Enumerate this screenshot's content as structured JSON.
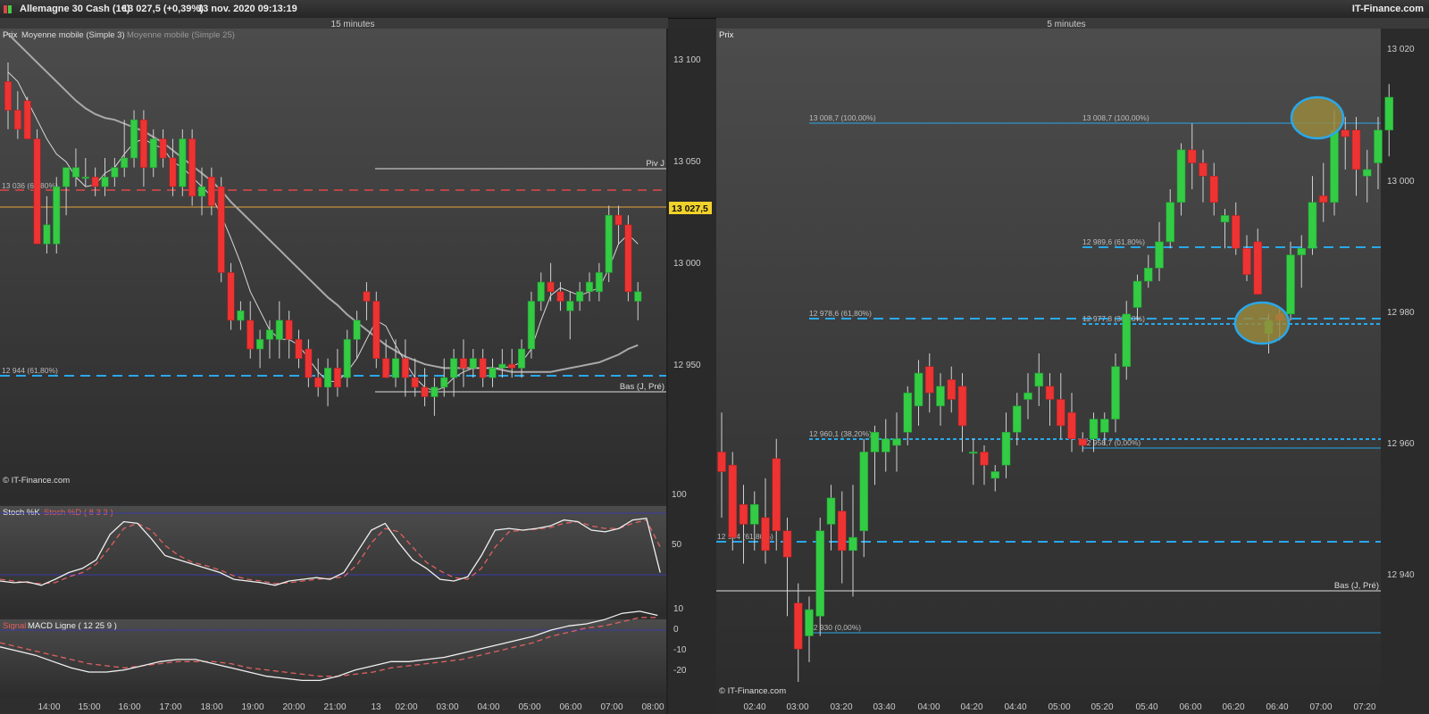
{
  "header": {
    "instrument": "Allemagne 30 Cash (1€)",
    "price": "13 027,5 (+0,39%)",
    "datetime": "13 nov. 2020 09:13:19",
    "brand": "IT-Finance.com"
  },
  "left": {
    "timeframe": "15 minutes",
    "legend": {
      "prix": "Prix",
      "ma3": "Moyenne mobile (Simple 3)",
      "ma25": "Moyenne mobile (Simple 25)"
    },
    "watermark": "© IT-Finance.com",
    "price_ticks": [
      "13 100",
      "13 050",
      "13 000",
      "12 950"
    ],
    "current_price": "13 027,5",
    "piv_label": "Piv J",
    "bas_label": "Bas (J, Pré)",
    "fib1": "13 036 (61,80%)",
    "fib2": "12 944 (61,80%)",
    "stoch": {
      "k": "Stoch %K",
      "d": "Stoch %D ( 8 3 3 )",
      "ticks": [
        "100",
        "50"
      ]
    },
    "macd": {
      "signal": "Signal",
      "line": "MACD Ligne ( 12 25 9 )",
      "ticks": [
        "10",
        "0",
        "-10",
        "-20"
      ]
    },
    "time_ticks": [
      "14:00",
      "15:00",
      "16:00",
      "17:00",
      "18:00",
      "19:00",
      "20:00",
      "21:00",
      "13",
      "02:00",
      "03:00",
      "04:00",
      "05:00",
      "06:00",
      "07:00",
      "08:00"
    ]
  },
  "right": {
    "timeframe": "5 minutes",
    "legend": {
      "prix": "Prix"
    },
    "watermark": "© IT-Finance.com",
    "price_ticks": [
      "13 020",
      "13 000",
      "12 980",
      "12 960",
      "12 940"
    ],
    "bas_label": "Bas (J, Pré)",
    "fibs": [
      "13 008,7 (100,00%)",
      "13 008,7 (100,00%)",
      "12 989,6 (61,80%)",
      "12 978,6 (61,80%)",
      "12 977,8 (38,20%)",
      "12 960,1 (38,20%)",
      "12 958,7 (0,00%)",
      "12 944 (61,80%)",
      "12 930 (0,00%)"
    ],
    "time_ticks": [
      "02:40",
      "03:00",
      "03:20",
      "03:40",
      "04:00",
      "04:20",
      "04:40",
      "05:00",
      "05:20",
      "05:40",
      "06:00",
      "06:20",
      "06:40",
      "07:00",
      "07:20"
    ]
  },
  "chart_data": [
    {
      "type": "candlestick",
      "title": "15 minutes",
      "ylim": [
        12920,
        13120
      ],
      "candles": [
        [
          13110,
          13120,
          13085,
          13095
        ],
        [
          13095,
          13105,
          13080,
          13085
        ],
        [
          13100,
          13102,
          13080,
          13080
        ],
        [
          13080,
          13085,
          13025,
          13025
        ],
        [
          13025,
          13050,
          13020,
          13035
        ],
        [
          13025,
          13060,
          13020,
          13055
        ],
        [
          13055,
          13065,
          13040,
          13065
        ],
        [
          13060,
          13075,
          13055,
          13065
        ],
        [
          13060,
          13070,
          13055,
          13060
        ],
        [
          13060,
          13065,
          13050,
          13055
        ],
        [
          13055,
          13070,
          13050,
          13060
        ],
        [
          13060,
          13070,
          13055,
          13065
        ],
        [
          13065,
          13090,
          13060,
          13070
        ],
        [
          13070,
          13095,
          13065,
          13090
        ],
        [
          13090,
          13095,
          13055,
          13065
        ],
        [
          13065,
          13085,
          13060,
          13080
        ],
        [
          13080,
          13085,
          13065,
          13070
        ],
        [
          13070,
          13080,
          13050,
          13055
        ],
        [
          13055,
          13085,
          13050,
          13080
        ],
        [
          13080,
          13085,
          13045,
          13050
        ],
        [
          13050,
          13065,
          13040,
          13055
        ],
        [
          13060,
          13065,
          13040,
          13045
        ],
        [
          13055,
          13060,
          13005,
          13010
        ],
        [
          13010,
          13015,
          12980,
          12985
        ],
        [
          12985,
          12995,
          12980,
          12990
        ],
        [
          12985,
          12995,
          12965,
          12970
        ],
        [
          12970,
          12980,
          12960,
          12975
        ],
        [
          12975,
          12985,
          12965,
          12980
        ],
        [
          12975,
          12995,
          12965,
          12985
        ],
        [
          12985,
          12990,
          12965,
          12975
        ],
        [
          12975,
          12980,
          12960,
          12965
        ],
        [
          12970,
          12975,
          12950,
          12955
        ],
        [
          12955,
          12965,
          12945,
          12950
        ],
        [
          12950,
          12965,
          12940,
          12960
        ],
        [
          12960,
          12970,
          12945,
          12950
        ],
        [
          12955,
          12980,
          12950,
          12975
        ],
        [
          12975,
          12990,
          12965,
          12985
        ],
        [
          13000,
          13005,
          12985,
          12995
        ],
        [
          12995,
          13000,
          12960,
          12965
        ],
        [
          12965,
          12975,
          12955,
          12955
        ],
        [
          12955,
          12975,
          12950,
          12965
        ],
        [
          12965,
          12975,
          12945,
          12955
        ],
        [
          12955,
          12965,
          12945,
          12950
        ],
        [
          12950,
          12960,
          12940,
          12945
        ],
        [
          12945,
          12955,
          12935,
          12950
        ],
        [
          12950,
          12965,
          12945,
          12955
        ],
        [
          12955,
          12970,
          12945,
          12965
        ],
        [
          12965,
          12975,
          12950,
          12960
        ],
        [
          12960,
          12970,
          12955,
          12965
        ],
        [
          12965,
          12970,
          12950,
          12955
        ],
        [
          12955,
          12965,
          12950,
          12960
        ],
        [
          12960,
          12970,
          12955,
          12962
        ],
        [
          12962,
          12970,
          12955,
          12960
        ],
        [
          12960,
          12975,
          12955,
          12970
        ],
        [
          12970,
          13000,
          12965,
          12995
        ],
        [
          12995,
          13010,
          12990,
          13005
        ],
        [
          13005,
          13015,
          12995,
          13000
        ],
        [
          13000,
          13005,
          12990,
          12995
        ],
        [
          12990,
          13000,
          12975,
          12995
        ],
        [
          12995,
          13005,
          12990,
          13000
        ],
        [
          13000,
          13010,
          12995,
          13005
        ],
        [
          13000,
          13015,
          12995,
          13010
        ],
        [
          13010,
          13045,
          13005,
          13040
        ],
        [
          13040,
          13045,
          13025,
          13035
        ],
        [
          13035,
          13040,
          12995,
          13000
        ],
        [
          12995,
          13005,
          12985,
          13000
        ]
      ],
      "ma3": [
        13115,
        13110,
        13100,
        13090,
        13080,
        13072,
        13068,
        13060,
        13055,
        13056,
        13062,
        13065,
        13072,
        13078,
        13080,
        13077,
        13075,
        13068,
        13065,
        13060,
        13055,
        13050,
        13040,
        13028,
        13015,
        13000,
        12990,
        12980,
        12975,
        12975,
        12972,
        12965,
        12958,
        12953,
        12953,
        12958,
        12965,
        12975,
        12985,
        12982,
        12972,
        12963,
        12955,
        12950,
        12948,
        12950,
        12955,
        12958,
        12960,
        12960,
        12960,
        12960,
        12961,
        12963,
        12970,
        12985,
        12998,
        13002,
        13000,
        12998,
        13000,
        13002,
        13012,
        13025,
        13030,
        13025
      ],
      "ma25": [
        13135,
        13130,
        13125,
        13120,
        13115,
        13110,
        13105,
        13100,
        13096,
        13093,
        13091,
        13090,
        13088,
        13086,
        13084,
        13081,
        13078,
        13074,
        13070,
        13066,
        13062,
        13058,
        13053,
        13047,
        13042,
        13037,
        13032,
        13027,
        13022,
        13017,
        13012,
        13007,
        13002,
        12997,
        12993,
        12988,
        12984,
        12980,
        12976,
        12972,
        12969,
        12966,
        12964,
        12962,
        12961,
        12960,
        12960,
        12960,
        12960,
        12960,
        12960,
        12959,
        12958,
        12958,
        12958,
        12958,
        12958,
        12959,
        12960,
        12961,
        12962,
        12963,
        12965,
        12967,
        12970,
        12972
      ],
      "levels": {
        "piv_j": 13048,
        "fib_36": 13036,
        "current": 13027.5,
        "fib_944": 12944,
        "bas": 12940
      }
    },
    {
      "type": "line",
      "title": "Stoch %K / Stoch %D ( 8 3 3 )",
      "ylim": [
        0,
        110
      ],
      "series": [
        {
          "name": "Stoch %K",
          "values": [
            20,
            18,
            19,
            15,
            22,
            30,
            35,
            45,
            75,
            90,
            88,
            70,
            50,
            45,
            40,
            35,
            30,
            22,
            20,
            18,
            15,
            20,
            22,
            24,
            22,
            30,
            55,
            80,
            88,
            65,
            45,
            35,
            22,
            20,
            25,
            50,
            80,
            82,
            80,
            82,
            85,
            92,
            90,
            80,
            78,
            82,
            92,
            94,
            30
          ]
        },
        {
          "name": "Stoch %D",
          "values": [
            22,
            20,
            18,
            17,
            18,
            25,
            30,
            40,
            60,
            82,
            88,
            80,
            62,
            50,
            42,
            38,
            33,
            26,
            22,
            20,
            17,
            18,
            20,
            22,
            23,
            25,
            40,
            65,
            82,
            78,
            60,
            42,
            32,
            24,
            22,
            35,
            60,
            78,
            80,
            81,
            83,
            88,
            90,
            85,
            82,
            82,
            88,
            92,
            60
          ]
        }
      ]
    },
    {
      "type": "line",
      "title": "MACD Ligne ( 12 25 9 )",
      "ylim": [
        -25,
        12
      ],
      "series": [
        {
          "name": "MACD Ligne",
          "values": [
            -8,
            -10,
            -12,
            -15,
            -18,
            -20,
            -20,
            -19,
            -17,
            -15,
            -14,
            -14,
            -16,
            -18,
            -20,
            -22,
            -23,
            -24,
            -24,
            -22,
            -19,
            -17,
            -15,
            -15,
            -14,
            -13,
            -11,
            -9,
            -7,
            -5,
            -3,
            0,
            2,
            3,
            5,
            8,
            9,
            7
          ]
        },
        {
          "name": "Signal",
          "values": [
            -6,
            -8,
            -10,
            -12,
            -14,
            -16,
            -17,
            -18,
            -17,
            -16,
            -15,
            -15,
            -15,
            -16,
            -18,
            -19,
            -20,
            -21,
            -22,
            -22,
            -21,
            -20,
            -18,
            -17,
            -16,
            -15,
            -14,
            -12,
            -10,
            -8,
            -6,
            -3,
            -1,
            1,
            2,
            4,
            6,
            6
          ]
        }
      ]
    },
    {
      "type": "candlestick",
      "title": "5 minutes",
      "ylim": [
        12925,
        13025
      ],
      "candles": [
        [
          12960,
          12966,
          12950,
          12957
        ],
        [
          12958,
          12960,
          12945,
          12947
        ],
        [
          12952,
          12955,
          12943,
          12949
        ],
        [
          12949,
          12954,
          12945,
          12952
        ],
        [
          12950,
          12956,
          12943,
          12945
        ],
        [
          12959,
          12962,
          12945,
          12948
        ],
        [
          12948,
          12950,
          12935,
          12944
        ],
        [
          12937,
          12940,
          12925,
          12930
        ],
        [
          12932,
          12938,
          12928,
          12936
        ],
        [
          12935,
          12950,
          12932,
          12948
        ],
        [
          12949,
          12955,
          12945,
          12953
        ],
        [
          12951,
          12954,
          12940,
          12945
        ],
        [
          12945,
          12955,
          12938,
          12947
        ],
        [
          12948,
          12962,
          12944,
          12960
        ],
        [
          12960,
          12964,
          12955,
          12963
        ],
        [
          12960,
          12965,
          12957,
          12962
        ],
        [
          12961,
          12966,
          12957,
          12962
        ],
        [
          12963,
          12970,
          12961,
          12969
        ],
        [
          12967,
          12974,
          12964,
          12972
        ],
        [
          12973,
          12975,
          12966,
          12969
        ],
        [
          12967,
          12972,
          12964,
          12970
        ],
        [
          12971,
          12973,
          12966,
          12968
        ],
        [
          12970,
          12972,
          12960,
          12964
        ],
        [
          12960,
          12962,
          12955,
          12960
        ],
        [
          12960,
          12961,
          12955,
          12958
        ],
        [
          12956,
          12958,
          12954,
          12957
        ],
        [
          12958,
          12966,
          12956,
          12963
        ],
        [
          12963,
          12969,
          12961,
          12967
        ],
        [
          12968,
          12972,
          12965,
          12969
        ],
        [
          12970,
          12975,
          12967,
          12972
        ],
        [
          12970,
          12972,
          12964,
          12968
        ],
        [
          12968,
          12972,
          12962,
          12964
        ],
        [
          12966,
          12969,
          12960,
          12962
        ],
        [
          12962,
          12963,
          12960,
          12961
        ],
        [
          12962,
          12966,
          12960,
          12965
        ],
        [
          12963,
          12966,
          12961,
          12965
        ],
        [
          12965,
          12975,
          12963,
          12973
        ],
        [
          12973,
          12983,
          12971,
          12981
        ],
        [
          12982,
          12987,
          12980,
          12986
        ],
        [
          12986,
          12990,
          12985,
          12988
        ],
        [
          12988,
          12995,
          12986,
          12992
        ],
        [
          12992,
          13000,
          12991,
          12998
        ],
        [
          12998,
          13007,
          12996,
          13006
        ],
        [
          13006,
          13010,
          13000,
          13004
        ],
        [
          13004,
          13006,
          12998,
          13002
        ],
        [
          13002,
          13004,
          12996,
          12998
        ],
        [
          12995,
          12997,
          12991,
          12996
        ],
        [
          12996,
          12998,
          12990,
          12991
        ],
        [
          12991,
          12993,
          12986,
          12987
        ],
        [
          12992,
          12994,
          12984,
          12984
        ],
        [
          12978,
          12981,
          12975,
          12980
        ],
        [
          12981,
          12982,
          12977,
          12980
        ],
        [
          12981,
          12992,
          12980,
          12990
        ],
        [
          12990,
          12993,
          12985,
          12991
        ],
        [
          12991,
          13002,
          12990,
          12998
        ],
        [
          12999,
          13004,
          12995,
          12998
        ],
        [
          12998,
          13012,
          12996,
          13009
        ],
        [
          13009,
          13011,
          13003,
          13008
        ],
        [
          13009,
          13011,
          12999,
          13003
        ],
        [
          13002,
          13006,
          12998,
          13003
        ],
        [
          13004,
          13011,
          13000,
          13009
        ],
        [
          13009,
          13016,
          13005,
          13014
        ]
      ],
      "levels": {
        "fib_100": 13008.7,
        "fib_989": 12989.6,
        "fib_978": 12978.6,
        "fib_977": 12977.8,
        "fib_960": 12960.1,
        "fib_958": 12958.7,
        "fib_944": 12944,
        "bas": 12937.5,
        "fib_930": 12930
      }
    }
  ],
  "colors": {
    "bull": "#33cc44",
    "bear": "#ee3333",
    "fib_blue": "#29a8ea",
    "fib_red": "#e04848",
    "current": "#e8a23a",
    "ma": "#c8c8c8",
    "stoch_line": "#3a3aa8",
    "highlight": "#9a8a3c"
  }
}
